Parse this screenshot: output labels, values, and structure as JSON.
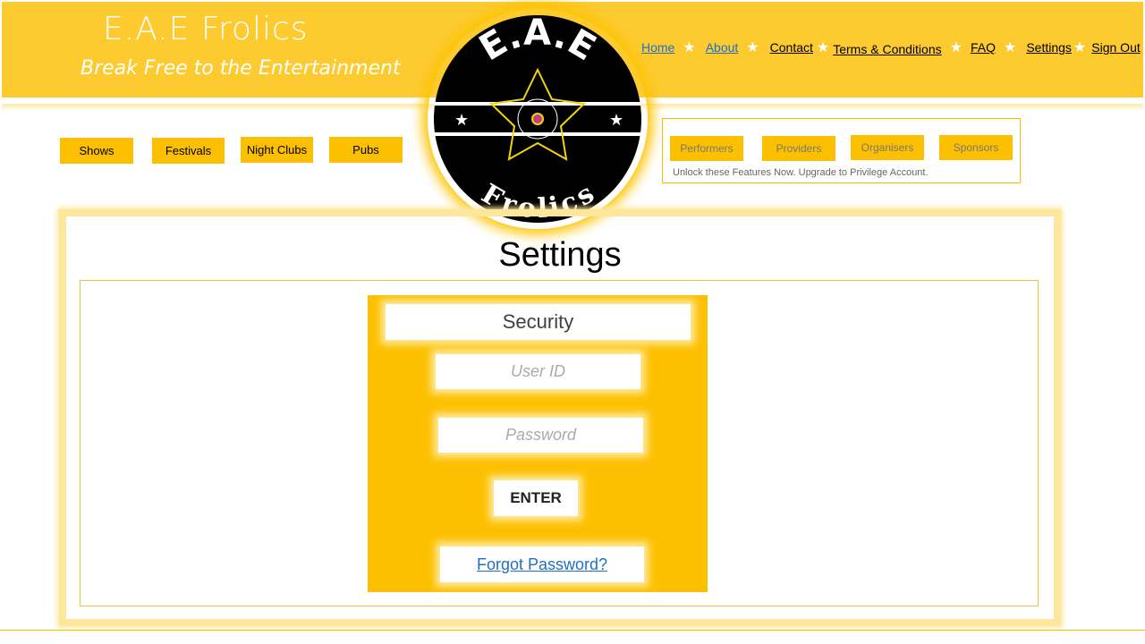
{
  "header": {
    "title": "E.A.E Frolics",
    "tagline": "Break Free to the Entertainment"
  },
  "logo": {
    "top_text": "E.A.E",
    "bottom_text": "Frolics"
  },
  "nav": [
    {
      "label": "Home"
    },
    {
      "label": "About"
    },
    {
      "label": "Contact"
    },
    {
      "label": "Terms & Conditions"
    },
    {
      "label": "FAQ"
    },
    {
      "label": "Settings"
    },
    {
      "label": "Sign Out"
    }
  ],
  "categories": [
    {
      "label": "Shows"
    },
    {
      "label": "Festivals"
    },
    {
      "label": "Night Clubs"
    },
    {
      "label": "Pubs"
    }
  ],
  "features": {
    "buttons": [
      {
        "label": "Performers"
      },
      {
        "label": "Providers"
      },
      {
        "label": "Organisers"
      },
      {
        "label": "Sponsors"
      }
    ],
    "note": "Unlock these Features Now.  Upgrade to Privilege Account."
  },
  "page": {
    "title": "Settings"
  },
  "security": {
    "title": "Security",
    "user_placeholder": "User ID",
    "password_placeholder": "Password",
    "enter_label": "ENTER",
    "forgot_label": "Forgot Password?"
  },
  "colors": {
    "brand": "#fdca30",
    "button": "#fdc000",
    "link": "#1f6fc6"
  }
}
